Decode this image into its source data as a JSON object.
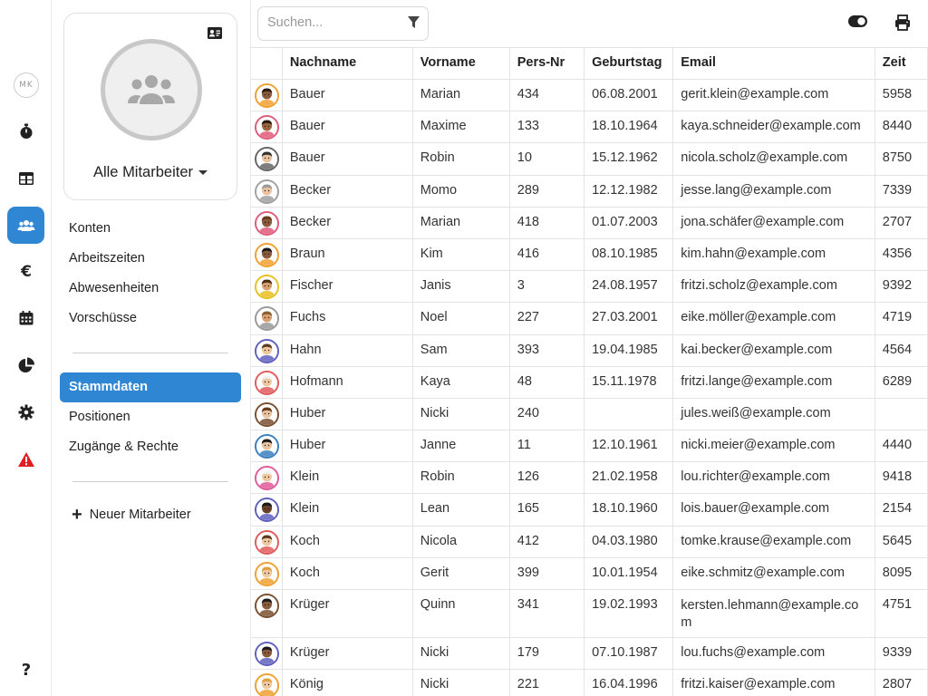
{
  "rail": {
    "user_initials": "MK",
    "items": [
      {
        "icon": "stopwatch-icon"
      },
      {
        "icon": "table-icon"
      },
      {
        "icon": "users-icon",
        "active": true
      },
      {
        "icon": "euro-icon"
      },
      {
        "icon": "calendar-icon"
      },
      {
        "icon": "pie-chart-icon"
      },
      {
        "icon": "gear-icon"
      },
      {
        "icon": "warning-icon"
      }
    ],
    "help_icon": "question-icon"
  },
  "sidebar": {
    "group_title": "Alle Mitarbeiter",
    "menu1": [
      {
        "label": "Konten"
      },
      {
        "label": "Arbeitszeiten"
      },
      {
        "label": "Abwesenheiten"
      },
      {
        "label": "Vorschüsse"
      }
    ],
    "menu2": [
      {
        "label": "Stammdaten",
        "active": true
      },
      {
        "label": "Positionen"
      },
      {
        "label": "Zugänge & Rechte"
      }
    ],
    "new_employee": "Neuer Mitarbeiter"
  },
  "search": {
    "placeholder": "Suchen..."
  },
  "table": {
    "headers": {
      "lastname": "Nachname",
      "firstname": "Vorname",
      "persnr": "Pers-Nr",
      "birthday": "Geburtstag",
      "email": "Email",
      "zeit": "Zeit"
    },
    "rows": [
      {
        "lastname": "Bauer",
        "firstname": "Marian",
        "persnr": "434",
        "birthday": "06.08.2001",
        "email": "gerit.klein@example.com",
        "zeit": "5958",
        "ring": "#f0a030",
        "skin": "#8a5a3c",
        "hair": "#2b1a10"
      },
      {
        "lastname": "Bauer",
        "firstname": "Maxime",
        "persnr": "133",
        "birthday": "18.10.1964",
        "email": "kaya.schneider@example.com",
        "zeit": "8440",
        "ring": "#e05a7a",
        "skin": "#9a6440",
        "hair": "#2b1a10"
      },
      {
        "lastname": "Bauer",
        "firstname": "Robin",
        "persnr": "10",
        "birthday": "15.12.1962",
        "email": "nicola.scholz@example.com",
        "zeit": "8750",
        "ring": "#666666",
        "skin": "#e9c3a0",
        "hair": "#333333"
      },
      {
        "lastname": "Becker",
        "firstname": "Momo",
        "persnr": "289",
        "birthday": "12.12.1982",
        "email": "jesse.lang@example.com",
        "zeit": "7339",
        "ring": "#a0a0a0",
        "skin": "#e9c3a0",
        "hair": "#9a9a9a"
      },
      {
        "lastname": "Becker",
        "firstname": "Marian",
        "persnr": "418",
        "birthday": "01.07.2003",
        "email": "jona.schäfer@example.com",
        "zeit": "2707",
        "ring": "#e05a7a",
        "skin": "#8a5a3c",
        "hair": "#6b3a1a"
      },
      {
        "lastname": "Braun",
        "firstname": "Kim",
        "persnr": "416",
        "birthday": "08.10.1985",
        "email": "kim.hahn@example.com",
        "zeit": "4356",
        "ring": "#f0a030",
        "skin": "#8a5a3c",
        "hair": "#1a1a1a"
      },
      {
        "lastname": "Fischer",
        "firstname": "Janis",
        "persnr": "3",
        "birthday": "24.08.1957",
        "email": "fritzi.scholz@example.com",
        "zeit": "9392",
        "ring": "#e8c020",
        "skin": "#d9a070",
        "hair": "#4a2a10"
      },
      {
        "lastname": "Fuchs",
        "firstname": "Noel",
        "persnr": "227",
        "birthday": "27.03.2001",
        "email": "eike.möller@example.com",
        "zeit": "4719",
        "ring": "#999999",
        "skin": "#d9a070",
        "hair": "#8a6030"
      },
      {
        "lastname": "Hahn",
        "firstname": "Sam",
        "persnr": "393",
        "birthday": "19.04.1985",
        "email": "kai.becker@example.com",
        "zeit": "4564",
        "ring": "#6060c0",
        "skin": "#f0c8a0",
        "hair": "#5a3a20"
      },
      {
        "lastname": "Hofmann",
        "firstname": "Kaya",
        "persnr": "48",
        "birthday": "15.11.1978",
        "email": "fritzi.lange@example.com",
        "zeit": "6289",
        "ring": "#e05a5a",
        "skin": "#f0c8a0",
        "hair": "#f0f0f0"
      },
      {
        "lastname": "Huber",
        "firstname": "Nicki",
        "persnr": "240",
        "birthday": "",
        "email": "jules.weiß@example.com",
        "zeit": "",
        "ring": "#7a5030",
        "skin": "#e9c3a0",
        "hair": "#6b3a1a"
      },
      {
        "lastname": "Huber",
        "firstname": "Janne",
        "persnr": "11",
        "birthday": "12.10.1961",
        "email": "nicki.meier@example.com",
        "zeit": "4440",
        "ring": "#3a80c0",
        "skin": "#e9c3a0",
        "hair": "#1a1a1a"
      },
      {
        "lastname": "Klein",
        "firstname": "Robin",
        "persnr": "126",
        "birthday": "21.02.1958",
        "email": "lou.richter@example.com",
        "zeit": "9418",
        "ring": "#e05a9a",
        "skin": "#f0c8a0",
        "hair": "#f0f0f0"
      },
      {
        "lastname": "Klein",
        "firstname": "Lean",
        "persnr": "165",
        "birthday": "18.10.1960",
        "email": "lois.bauer@example.com",
        "zeit": "2154",
        "ring": "#6060c0",
        "skin": "#6a4028",
        "hair": "#1a1a1a"
      },
      {
        "lastname": "Koch",
        "firstname": "Nicola",
        "persnr": "412",
        "birthday": "04.03.1980",
        "email": "tomke.krause@example.com",
        "zeit": "5645",
        "ring": "#e05a5a",
        "skin": "#f0c8a0",
        "hair": "#5a3a20"
      },
      {
        "lastname": "Koch",
        "firstname": "Gerit",
        "persnr": "399",
        "birthday": "10.01.1954",
        "email": "eike.schmitz@example.com",
        "zeit": "8095",
        "ring": "#f0a030",
        "skin": "#f0c8a0",
        "hair": "#e0a040"
      },
      {
        "lastname": "Krüger",
        "firstname": "Quinn",
        "persnr": "341",
        "birthday": "19.02.1993",
        "email": "kersten.lehmann@example.com",
        "zeit": "4751",
        "ring": "#7a5030",
        "skin": "#8a5a3c",
        "hair": "#1a1a1a",
        "tall": true
      },
      {
        "lastname": "Krüger",
        "firstname": "Nicki",
        "persnr": "179",
        "birthday": "07.10.1987",
        "email": "lou.fuchs@example.com",
        "zeit": "9339",
        "ring": "#6060c0",
        "skin": "#8a5a3c",
        "hair": "#1a1a1a"
      },
      {
        "lastname": "König",
        "firstname": "Nicki",
        "persnr": "221",
        "birthday": "16.04.1996",
        "email": "fritzi.kaiser@example.com",
        "zeit": "2807",
        "ring": "#f0a030",
        "skin": "#f0c8a0",
        "hair": "#e0a040"
      }
    ]
  },
  "colors": {
    "accent": "#2f86d3",
    "warning": "#e02020"
  }
}
